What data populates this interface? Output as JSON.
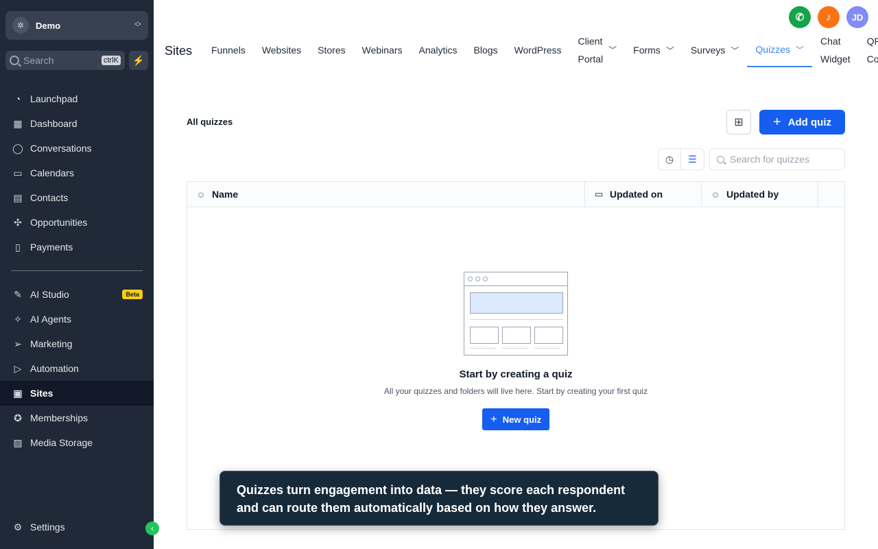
{
  "sidebar": {
    "account_name": "Demo",
    "search_placeholder": "Search",
    "search_shortcut": "ctrlK",
    "items_top": [
      {
        "label": "Launchpad",
        "icon": "rocket-icon"
      },
      {
        "label": "Dashboard",
        "icon": "grid-icon"
      },
      {
        "label": "Conversations",
        "icon": "chat-icon"
      },
      {
        "label": "Calendars",
        "icon": "calendar-icon"
      },
      {
        "label": "Contacts",
        "icon": "contacts-icon"
      },
      {
        "label": "Opportunities",
        "icon": "opportunities-icon"
      },
      {
        "label": "Payments",
        "icon": "payments-icon"
      }
    ],
    "items_bottom": [
      {
        "label": "AI Studio",
        "icon": "ai-studio-icon",
        "badge": "Beta"
      },
      {
        "label": "AI Agents",
        "icon": "sparkle-icon"
      },
      {
        "label": "Marketing",
        "icon": "send-icon"
      },
      {
        "label": "Automation",
        "icon": "play-icon"
      },
      {
        "label": "Sites",
        "icon": "sites-icon",
        "active": true
      },
      {
        "label": "Memberships",
        "icon": "award-icon"
      },
      {
        "label": "Media Storage",
        "icon": "image-icon"
      }
    ],
    "settings_label": "Settings"
  },
  "topbar": {
    "avatar_initials": "JD",
    "colors": {
      "phone": "#16a34a",
      "bell": "#f97316",
      "avatar": "#818cf8"
    }
  },
  "header": {
    "title": "Sites",
    "tabs": [
      {
        "label": "Funnels"
      },
      {
        "label": "Websites"
      },
      {
        "label": "Stores"
      },
      {
        "label": "Webinars"
      },
      {
        "label": "Analytics"
      },
      {
        "label": "Blogs"
      },
      {
        "label": "WordPress"
      },
      {
        "line1": "Client",
        "line2": "Portal",
        "dropdown": true
      },
      {
        "label": "Forms",
        "dropdown": true
      },
      {
        "label": "Surveys",
        "dropdown": true
      },
      {
        "label": "Quizzes",
        "dropdown": true,
        "active": true
      },
      {
        "line1": "Chat",
        "line2": "Widget"
      },
      {
        "line1": "QR",
        "line2": "Co"
      }
    ]
  },
  "main": {
    "section_title": "All quizzes",
    "add_button": "Add quiz",
    "search_placeholder": "Search for quizzes",
    "columns": [
      "Name",
      "Updated on",
      "Updated by"
    ],
    "empty_title": "Start by creating a quiz",
    "empty_subtitle": "All your quizzes and folders will live here. Start by creating your first quiz",
    "new_button": "New quiz",
    "accent_color": "#155eef"
  },
  "tooltip": {
    "text": "Quizzes turn engagement into data — they score each respondent and can route them automatically based on how they answer."
  }
}
